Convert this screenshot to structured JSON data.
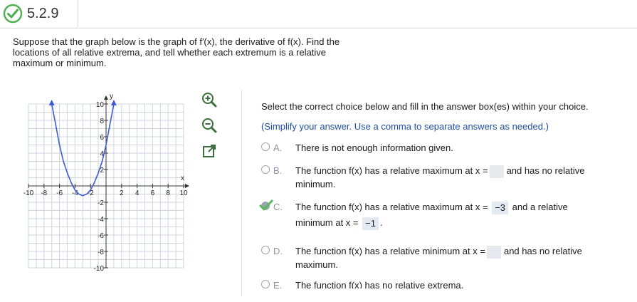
{
  "header": {
    "question_number": "5.2.9",
    "status_icon": "check-circle-icon",
    "status_color": "#4caf50"
  },
  "prompt": {
    "line1": "Suppose that the graph below is the graph of f′(x), the derivative of f(x). Find the",
    "line2": "locations of all relative extrema, and tell whether each extremum is a relative",
    "line3": "maximum or minimum."
  },
  "graph": {
    "x_axis_label": "x",
    "y_axis_label": "y",
    "x_ticks": [
      "-10",
      "-8",
      "-6",
      "-4",
      "-2",
      "2",
      "4",
      "6",
      "8",
      "10"
    ],
    "y_ticks": [
      "10",
      "8",
      "6",
      "4",
      "2",
      "-2",
      "-4",
      "-6",
      "-8",
      "-10"
    ],
    "curve_color": "#3b5bdb",
    "grid_color": "#cfd6de"
  },
  "chart_data": {
    "type": "line",
    "xlabel": "x",
    "ylabel": "y",
    "xlim": [
      -10,
      10
    ],
    "ylim": [
      -10,
      10
    ],
    "grid": true,
    "series": [
      {
        "x": [
          -7.0,
          -6.5,
          -6.0,
          -5.5,
          -5.0,
          -4.5,
          -4.0,
          -3.5,
          -3.0,
          -2.5,
          -2.0,
          -1.5,
          -1.0,
          -0.5,
          0.0,
          0.5,
          1.0
        ],
        "y": [
          10.0,
          7.5,
          5.0,
          3.0,
          1.6,
          0.4,
          -0.5,
          -1.0,
          -1.2,
          -1.0,
          -0.5,
          0.4,
          1.6,
          3.0,
          5.0,
          7.5,
          10.0
        ],
        "color": "#3b5bdb"
      }
    ]
  },
  "tools": {
    "zoom_in_icon": "zoom-in-icon",
    "zoom_out_icon": "zoom-out-icon",
    "popout_icon": "popout-icon"
  },
  "answer_panel": {
    "instruction": "Select the correct choice below and fill in the answer box(es) within your choice.",
    "hint": "(Simplify your answer. Use a comma to separate answers as needed.)",
    "choices": [
      {
        "letter": "A.",
        "line1": "There is not enough information given."
      },
      {
        "letter": "B.",
        "line1_pre": "The function f(x) has a relative maximum at x =",
        "line1_post": "and has no relative",
        "line2": "minimum."
      },
      {
        "letter": "C.",
        "line1_pre": "The function f(x) has a relative maximum at x =",
        "answer1": "−3",
        "line1_post": "and a relative",
        "line2_pre": "minimum at x =",
        "answer2": "−1",
        "line2_post": ".",
        "selected": true
      },
      {
        "letter": "D.",
        "line1_pre": "The function f(x) has a relative minimum at x =",
        "line1_post": "and has no relative",
        "line2": "maximum."
      },
      {
        "letter": "E.",
        "line1": "The function f(x) has no relative extrema."
      }
    ]
  }
}
